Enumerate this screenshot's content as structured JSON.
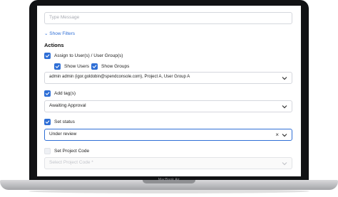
{
  "device": {
    "label": "MacBook Air"
  },
  "form": {
    "message": {
      "placeholder": "Type Message"
    },
    "show_filters": "Show Filters",
    "actions": {
      "title": "Actions",
      "assign": {
        "label": "Assign to User(s) / User Group(s)",
        "checked": true
      },
      "show_users": {
        "label": "Show Users",
        "checked": true
      },
      "show_groups": {
        "label": "Show Groups",
        "checked": true
      },
      "assignees_value": "admin admin (igor.goldobin@spendconsole.com), Project A, User Group A",
      "add_tags": {
        "label": "Add tag(s)",
        "checked": true
      },
      "tag_value": "Awaiting Approval",
      "set_status": {
        "label": "Set status",
        "checked": true
      },
      "status_value": "Under review",
      "set_project_code": {
        "label": "Set Project Code",
        "checked": false
      },
      "project_code_placeholder": "Select Project Code *"
    }
  },
  "colors": {
    "accent": "#2f6fd6",
    "frame": "#111214"
  }
}
